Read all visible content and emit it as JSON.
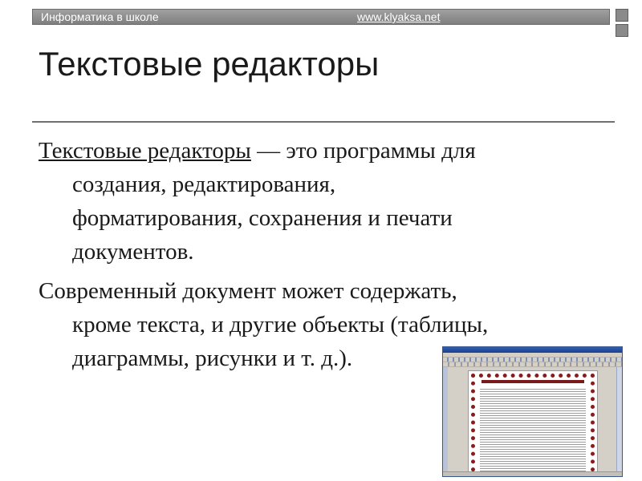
{
  "header": {
    "left_text": "Информатика в школе",
    "link_text": "www.klyaksa.net"
  },
  "slide": {
    "title": "Текстовые редакторы",
    "paragraph1": {
      "term": "Текстовые редакторы",
      "line1_rest": " — это программы для",
      "line2": "создания, редактирования,",
      "line3": "форматирования, сохранения и печати",
      "line4": "документов."
    },
    "paragraph2": {
      "line1": "Современный документ может содержать,",
      "line2": "кроме текста, и другие объекты (таблицы,",
      "line3": "диаграммы, рисунки и т. д.)."
    }
  },
  "colors": {
    "header_bar": "#8c8c8c",
    "page_border": "#8a1c1c",
    "window_titlebar": "#2f5fb7"
  }
}
